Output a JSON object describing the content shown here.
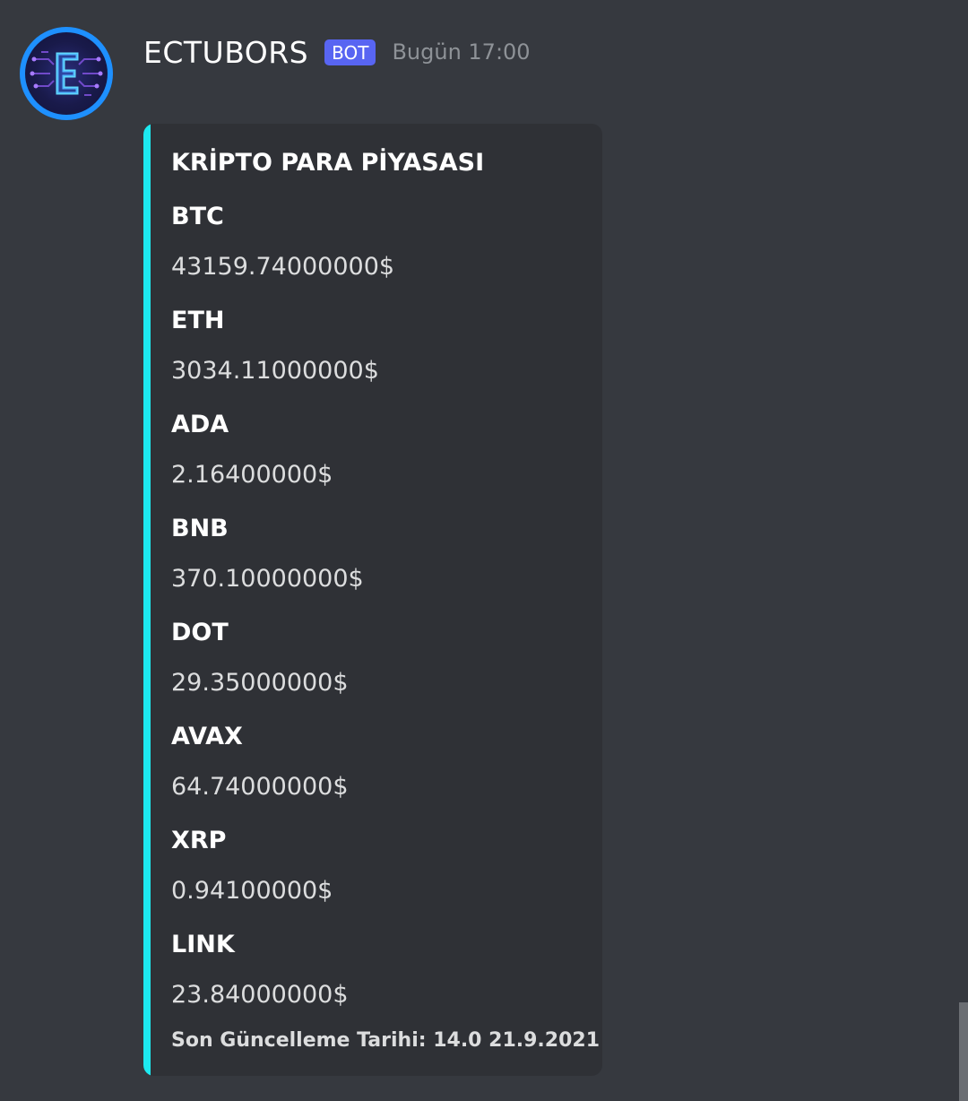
{
  "message": {
    "username": "ECTUBORS",
    "bot_tag": "BOT",
    "timestamp": "Bugün 17:00",
    "avatar_icon": "letter-e-circuit-logo"
  },
  "embed": {
    "accent_color": "#1de9f0",
    "title": "KRİPTO PARA PİYASASI",
    "fields": [
      {
        "name": "BTC",
        "value": "43159.74000000$"
      },
      {
        "name": "ETH",
        "value": "3034.11000000$"
      },
      {
        "name": "ADA",
        "value": "2.16400000$"
      },
      {
        "name": "BNB",
        "value": "370.10000000$"
      },
      {
        "name": "DOT",
        "value": "29.35000000$"
      },
      {
        "name": "AVAX",
        "value": "64.74000000$"
      },
      {
        "name": "XRP",
        "value": "0.94100000$"
      },
      {
        "name": "LINK",
        "value": "23.84000000$"
      }
    ],
    "footer": "Son Güncelleme Tarihi: 14.0  21.9.2021"
  },
  "colors": {
    "background": "#36393f",
    "embed_background": "#2f3136",
    "bot_tag": "#5865f2"
  }
}
